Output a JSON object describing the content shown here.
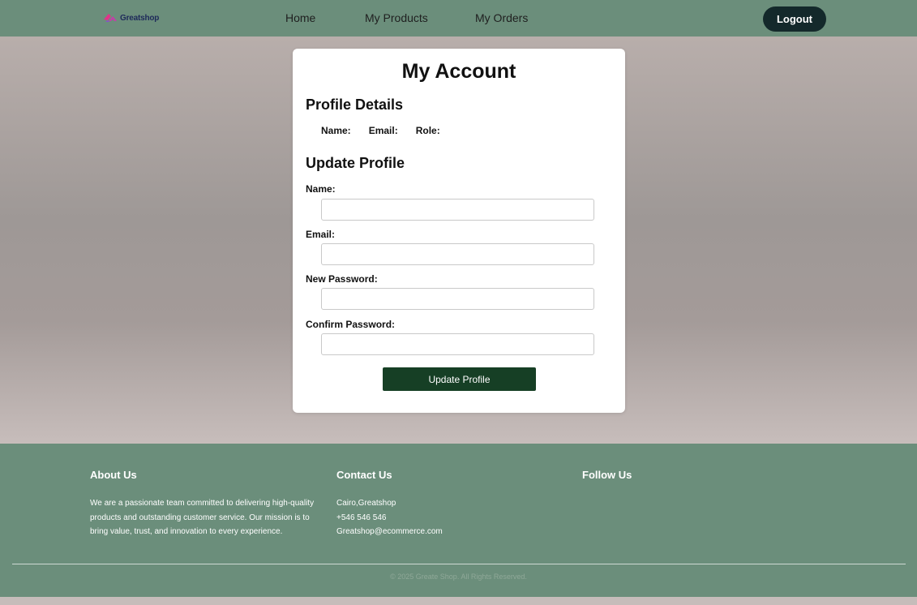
{
  "header": {
    "logo_text": "Greatshop",
    "nav": {
      "home": "Home",
      "my_products": "My Products",
      "my_orders": "My Orders"
    },
    "logout_label": "Logout"
  },
  "account": {
    "title": "My Account",
    "profile_details": {
      "heading": "Profile Details",
      "name_label": "Name:",
      "email_label": "Email:",
      "role_label": "Role:"
    },
    "update_profile": {
      "heading": "Update Profile",
      "name_label": "Name:",
      "name_value": "",
      "email_label": "Email:",
      "email_value": "",
      "new_password_label": "New Password:",
      "new_password_value": "",
      "confirm_password_label": "Confirm Password:",
      "confirm_password_value": "",
      "submit_label": "Update Profile"
    }
  },
  "footer": {
    "about": {
      "heading": "About Us",
      "text": "We are a passionate team committed to delivering high-quality products and outstanding customer service. Our mission is to bring value, trust, and innovation to every experience."
    },
    "contact": {
      "heading": "Contact Us",
      "address": "Cairo,Greatshop",
      "phone": "+546 546 546",
      "email": "Greatshop@ecommerce.com"
    },
    "follow": {
      "heading": "Follow Us"
    },
    "copyright": "© 2025 Greate Shop. All Rights Reserved."
  },
  "colors": {
    "header_bg": "#6b8e7b",
    "logout_bg": "#14292b",
    "submit_bg": "#163f25",
    "logo_pink": "#e0338a",
    "logo_text": "#1e2a5a"
  },
  "icons": {
    "logo": "greatshop-logo-icon"
  }
}
